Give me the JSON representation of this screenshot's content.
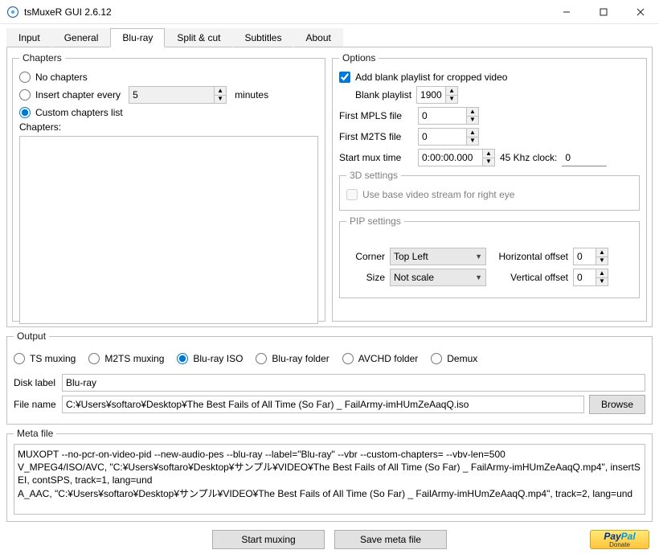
{
  "window": {
    "title": "tsMuxeR GUI 2.6.12"
  },
  "tabs": {
    "input": "Input",
    "general": "General",
    "bluray": "Blu-ray",
    "split": "Split & cut",
    "subtitles": "Subtitles",
    "about": "About"
  },
  "chapters": {
    "legend": "Chapters",
    "no_chapters": "No chapters",
    "insert_every": "Insert chapter every",
    "insert_value": "5",
    "minutes": "minutes",
    "custom": "Custom chapters list",
    "chapters_lbl": "Chapters:"
  },
  "options": {
    "legend": "Options",
    "add_blank": "Add blank playlist for cropped video",
    "blank_playlist_lbl": "Blank playlist",
    "blank_playlist_val": "1900",
    "first_mpls_lbl": "First MPLS file",
    "first_mpls_val": "0",
    "first_m2ts_lbl": "First M2TS file",
    "first_m2ts_val": "0",
    "start_mux_lbl": "Start mux time",
    "start_mux_val": "0:00:00.000",
    "khz_lbl": "45 Khz clock:",
    "khz_val": "0",
    "three_d": {
      "legend": "3D settings",
      "use_base": "Use base video stream for right eye"
    },
    "pip": {
      "legend": "PIP settings",
      "corner_lbl": "Corner",
      "corner_val": "Top Left",
      "size_lbl": "Size",
      "size_val": "Not scale",
      "h_off_lbl": "Horizontal offset",
      "h_off_val": "0",
      "v_off_lbl": "Vertical offset",
      "v_off_val": "0"
    }
  },
  "output": {
    "legend": "Output",
    "ts": "TS muxing",
    "m2ts": "M2TS muxing",
    "iso": "Blu-ray ISO",
    "folder": "Blu-ray folder",
    "avchd": "AVCHD folder",
    "demux": "Demux",
    "disk_lbl": "Disk label",
    "disk_val": "Blu-ray",
    "file_lbl": "File name",
    "file_val": "C:¥Users¥softaro¥Desktop¥The Best Fails of All Time (So Far) _ FailArmy-imHUmZeAaqQ.iso",
    "browse": "Browse"
  },
  "meta": {
    "legend": "Meta file",
    "line1": "MUXOPT --no-pcr-on-video-pid --new-audio-pes --blu-ray --label=\"Blu-ray\" --vbr  --custom-chapters= --vbv-len=500",
    "line2": "V_MPEG4/ISO/AVC, \"C:¥Users¥softaro¥Desktop¥サンプル¥VIDEO¥The Best Fails of All Time (So Far) _ FailArmy-imHUmZeAaqQ.mp4\", insertSEI, contSPS, track=1, lang=und",
    "line3": "A_AAC, \"C:¥Users¥softaro¥Desktop¥サンプル¥VIDEO¥The Best Fails of All Time (So Far) _ FailArmy-imHUmZeAaqQ.mp4\", track=2, lang=und"
  },
  "footer": {
    "start": "Start muxing",
    "save": "Save meta file",
    "donate": "Donate"
  }
}
